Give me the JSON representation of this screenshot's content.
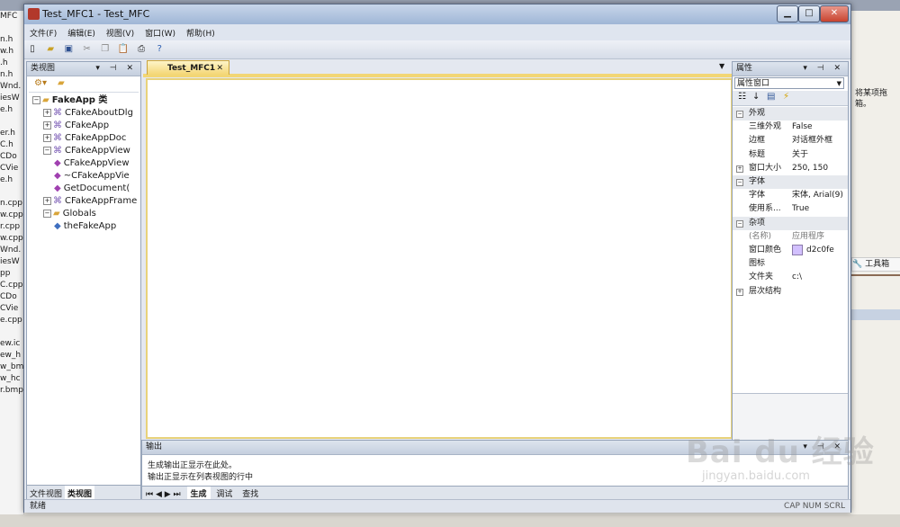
{
  "window": {
    "title": "Test_MFC1 - Test_MFC"
  },
  "menu": [
    "文件(F)",
    "编辑(E)",
    "视图(V)",
    "窗口(W)",
    "帮助(H)"
  ],
  "class_view": {
    "title": "类视图",
    "tree": [
      {
        "label": "FakeApp 类",
        "level": 0,
        "expander": "⊟",
        "icon": "folder-icon",
        "bold": true
      },
      {
        "label": "CFakeAboutDlg",
        "level": 1,
        "expander": "⊞",
        "icon": "class-icon"
      },
      {
        "label": "CFakeApp",
        "level": 1,
        "expander": "⊞",
        "icon": "class-icon"
      },
      {
        "label": "CFakeAppDoc",
        "level": 1,
        "expander": "⊞",
        "icon": "class-icon"
      },
      {
        "label": "CFakeAppView",
        "level": 1,
        "expander": "⊟",
        "icon": "class-icon"
      },
      {
        "label": "CFakeAppView",
        "level": 2,
        "icon": "method-icon"
      },
      {
        "label": "~CFakeAppVie",
        "level": 2,
        "icon": "method-icon"
      },
      {
        "label": "GetDocument(",
        "level": 2,
        "icon": "method-icon"
      },
      {
        "label": "CFakeAppFrame",
        "level": 1,
        "expander": "⊞",
        "icon": "class-icon"
      },
      {
        "label": "Globals",
        "level": 1,
        "expander": "⊟",
        "icon": "folder-icon"
      },
      {
        "label": "theFakeApp",
        "level": 2,
        "icon": "variable-icon"
      }
    ],
    "tabs": [
      "文件视图",
      "类视图"
    ]
  },
  "document": {
    "tab_label": "Test_MFC1"
  },
  "properties": {
    "title": "属性",
    "selector": "属性窗口",
    "rows": [
      {
        "type": "cat",
        "key": "外观"
      },
      {
        "key": "三维外观",
        "value": "False"
      },
      {
        "key": "边框",
        "value": "对话框外框"
      },
      {
        "key": "标题",
        "value": "关于"
      },
      {
        "type": "sub",
        "key": "窗口大小",
        "value": "250, 150"
      },
      {
        "type": "cat",
        "key": "字体"
      },
      {
        "key": "字体",
        "value": "宋体, Arial(9)"
      },
      {
        "key": "使用系...",
        "value": "True"
      },
      {
        "type": "cat",
        "key": "杂项"
      },
      {
        "key": "(名称)",
        "value": "应用程序",
        "dim": true
      },
      {
        "key": "窗口颜色",
        "value": "d2c0fe",
        "swatch": "#d2c0fe"
      },
      {
        "key": "图标",
        "value": ""
      },
      {
        "key": "文件夹",
        "value": "c:\\"
      },
      {
        "type": "sub",
        "key": "层次结构",
        "value": ""
      }
    ]
  },
  "output": {
    "title": "输出",
    "lines": [
      "生成输出正显示在此处。",
      "输出正显示在列表视图的行中"
    ],
    "tabs": [
      "生成",
      "调试",
      "查找"
    ]
  },
  "statusbar": {
    "left": "就绪",
    "right": "CAP  NUM  SCRL"
  },
  "background_left": [
    "MFC",
    "",
    "n.h",
    "w.h",
    ".h",
    "n.h",
    "Wnd.",
    "iesW",
    "e.h",
    "",
    "er.h",
    "C.h",
    "CDo",
    "CVie",
    "e.h",
    "",
    "n.cpp",
    "w.cpp",
    "r.cpp",
    "w.cpp",
    "Wnd.",
    "iesW",
    "pp",
    "C.cpp",
    "CDo",
    "CVie",
    "e.cpp",
    "",
    "ew.ic",
    "ew_h",
    "w_bm",
    "w_hc",
    "r.bmp"
  ],
  "side_note": "将某项拖箱。",
  "toolbox_label": "工具箱",
  "watermark": {
    "logo": "Bai du 经验",
    "url": "jingyan.baidu.com"
  }
}
